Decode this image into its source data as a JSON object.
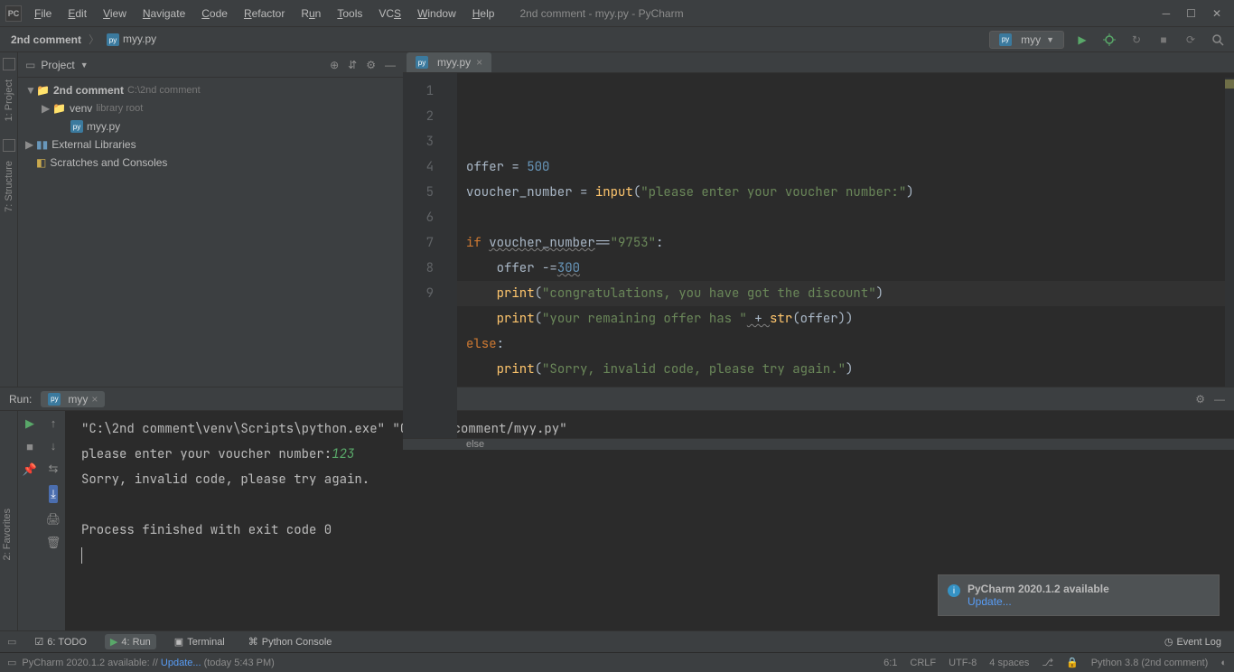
{
  "title": "2nd comment - myy.py - PyCharm",
  "menu": [
    "File",
    "Edit",
    "View",
    "Navigate",
    "Code",
    "Refactor",
    "Run",
    "Tools",
    "VCS",
    "Window",
    "Help"
  ],
  "breadcrumb": {
    "project": "2nd comment",
    "file": "myy.py"
  },
  "run_config": "myy",
  "project_panel": {
    "title": "Project",
    "project_name": "2nd comment",
    "project_path": "C:\\2nd comment",
    "venv": "venv",
    "venv_hint": "library root",
    "file": "myy.py",
    "libs": "External Libraries",
    "scratches": "Scratches and Consoles"
  },
  "editor": {
    "tab": "myy.py",
    "line_numbers": [
      "1",
      "2",
      "3",
      "4",
      "5",
      "6",
      "7",
      "8",
      "9"
    ],
    "lines": [
      {
        "indent": 0,
        "segments": [
          {
            "t": "offer ",
            "c": ""
          },
          {
            "t": "= ",
            "c": ""
          },
          {
            "t": "500",
            "c": "n"
          }
        ]
      },
      {
        "indent": 0,
        "segments": [
          {
            "t": "voucher_number ",
            "c": ""
          },
          {
            "t": "= ",
            "c": ""
          },
          {
            "t": "input",
            "c": "fn"
          },
          {
            "t": "(",
            "c": ""
          },
          {
            "t": "\"please enter your voucher number:\"",
            "c": "s"
          },
          {
            "t": ")",
            "c": ""
          }
        ]
      },
      {
        "indent": 0,
        "segments": []
      },
      {
        "indent": 0,
        "segments": [
          {
            "t": "if ",
            "c": "k"
          },
          {
            "t": "voucher_number",
            "c": "wavy"
          },
          {
            "t": "==",
            "c": ""
          },
          {
            "t": "\"9753\"",
            "c": "s"
          },
          {
            "t": ":",
            "c": ""
          }
        ]
      },
      {
        "indent": 1,
        "segments": [
          {
            "t": "offer ",
            "c": ""
          },
          {
            "t": "-=",
            "c": ""
          },
          {
            "t": "300",
            "c": "n wavy"
          }
        ]
      },
      {
        "indent": 1,
        "segments": [
          {
            "t": "print",
            "c": "fn"
          },
          {
            "t": "(",
            "c": ""
          },
          {
            "t": "\"congratulations, you have got the discount\"",
            "c": "s"
          },
          {
            "t": ")",
            "c": ""
          }
        ]
      },
      {
        "indent": 1,
        "segments": [
          {
            "t": "print",
            "c": "fn"
          },
          {
            "t": "(",
            "c": ""
          },
          {
            "t": "\"your remaining offer has \"",
            "c": "s"
          },
          {
            "t": " + ",
            "c": "wavy"
          },
          {
            "t": "str",
            "c": "fn"
          },
          {
            "t": "(offer))",
            "c": ""
          }
        ]
      },
      {
        "indent": 0,
        "segments": [
          {
            "t": "else",
            "c": "k"
          },
          {
            "t": ":",
            "c": ""
          }
        ]
      },
      {
        "indent": 1,
        "segments": [
          {
            "t": "print",
            "c": "fn"
          },
          {
            "t": "(",
            "c": ""
          },
          {
            "t": "\"Sorry, invalid code, please try again.\"",
            "c": "s"
          },
          {
            "t": ")",
            "c": ""
          }
        ]
      }
    ],
    "crumb": "else"
  },
  "run_tool": {
    "label": "Run:",
    "tab": "myy",
    "lines": [
      "\"C:\\2nd comment\\venv\\Scripts\\python.exe\" \"C:/2nd comment/myy.py\"",
      "please enter your voucher number:",
      "Sorry, invalid code, please try again.",
      "",
      "Process finished with exit code 0"
    ],
    "user_input": "123"
  },
  "notification": {
    "title": "PyCharm 2020.1.2 available",
    "link": "Update..."
  },
  "bottom_tabs": {
    "todo": "6: TODO",
    "run": "4: Run",
    "terminal": "Terminal",
    "pycon": "Python Console",
    "event": "Event Log"
  },
  "status": {
    "left": "PyCharm 2020.1.2 available: // ",
    "left_link": "Update...",
    "left_suffix": " (today 5:43 PM)",
    "pos": "6:1",
    "crlf": "CRLF",
    "enc": "UTF-8",
    "indent": "4 spaces",
    "python": "Python 3.8 (2nd comment)"
  },
  "gutter": {
    "project": "1: Project",
    "structure": "7: Structure",
    "favorites": "2: Favorites"
  }
}
